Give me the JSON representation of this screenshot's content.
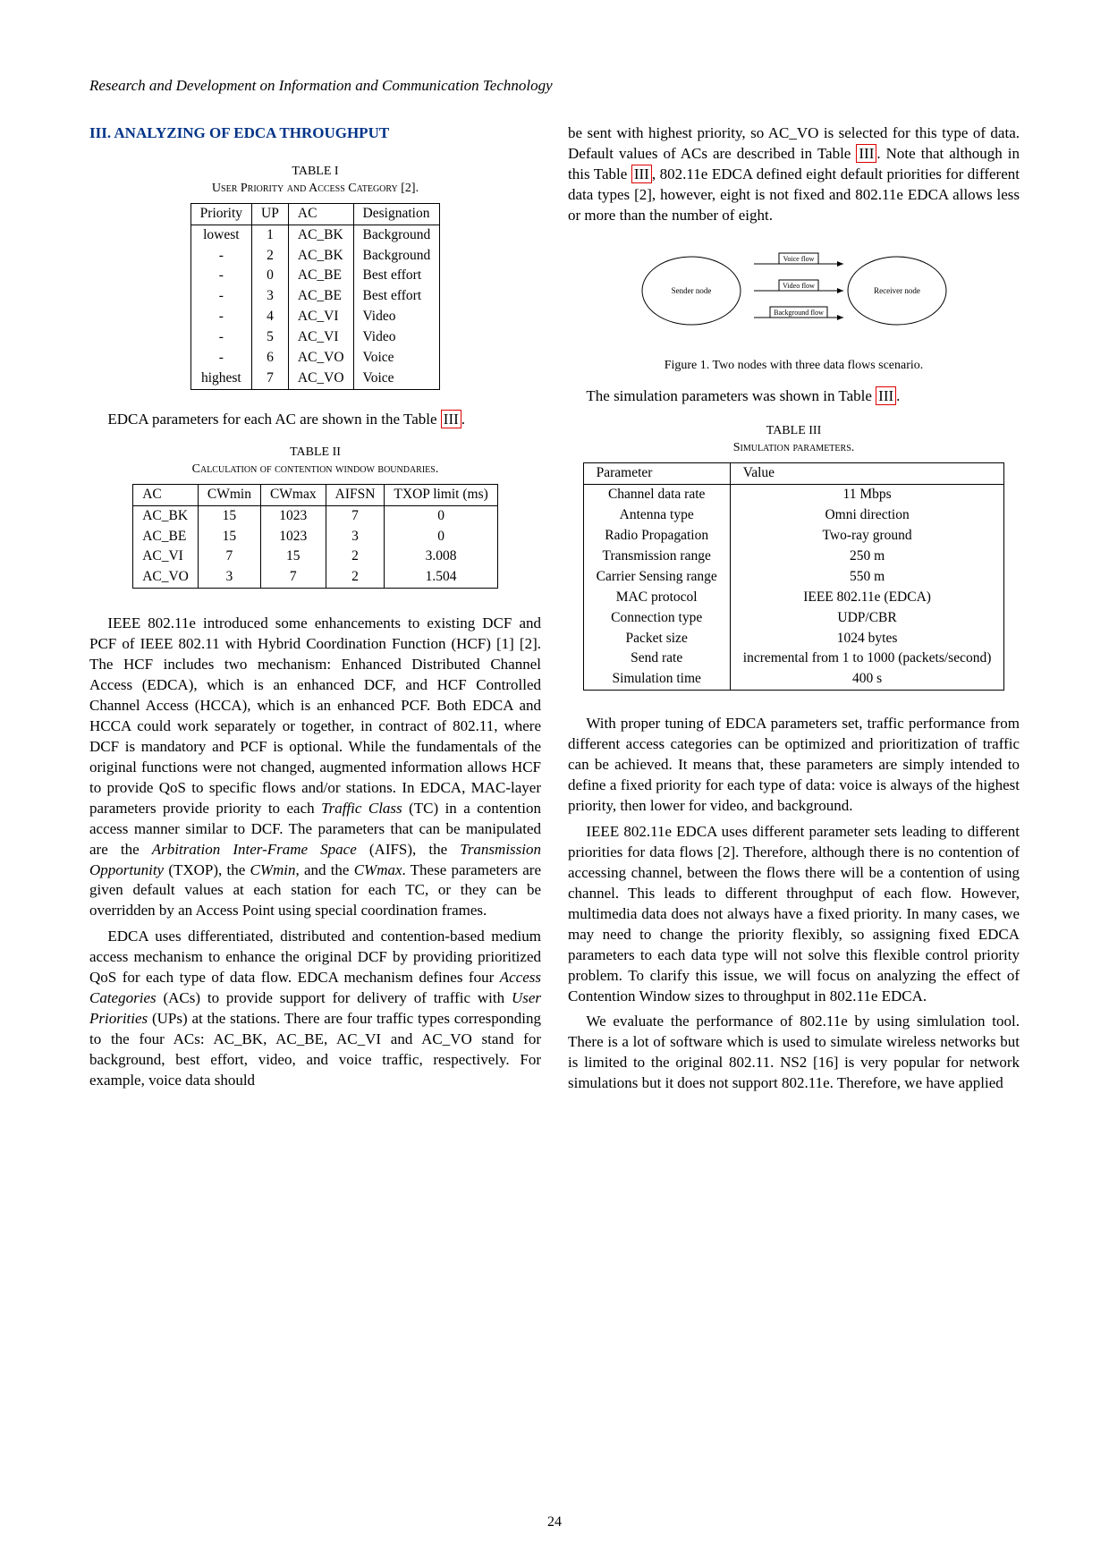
{
  "header": "Research and Development on Information and Communication Technology",
  "section_title": "III. ANALYZING OF EDCA THROUGHPUT",
  "page_number": "24",
  "table1": {
    "label": "TABLE I",
    "caption_pre": "User Priority and Access Category [",
    "caption_ref": "2",
    "caption_post": "].",
    "headers": [
      "Priority",
      "UP",
      "AC",
      "Designation"
    ],
    "rows": [
      [
        "lowest",
        "1",
        "AC_BK",
        "Background"
      ],
      [
        "-",
        "2",
        "AC_BK",
        "Background"
      ],
      [
        "-",
        "0",
        "AC_BE",
        "Best effort"
      ],
      [
        "-",
        "3",
        "AC_BE",
        "Best effort"
      ],
      [
        "-",
        "4",
        "AC_VI",
        "Video"
      ],
      [
        "-",
        "5",
        "AC_VI",
        "Video"
      ],
      [
        "-",
        "6",
        "AC_VO",
        "Voice"
      ],
      [
        "highest",
        "7",
        "AC_VO",
        "Voice"
      ]
    ]
  },
  "para_after_t1_a": "EDCA parameters for each AC are shown in the Table ",
  "para_after_t1_ref": "III",
  "para_after_t1_b": ".",
  "table2": {
    "label": "TABLE II",
    "caption": "Calculation of contention window boundaries.",
    "headers": [
      "AC",
      "CWmin",
      "CWmax",
      "AIFSN",
      "TXOP limit (ms)"
    ],
    "rows": [
      [
        "AC_BK",
        "15",
        "1023",
        "7",
        "0"
      ],
      [
        "AC_BE",
        "15",
        "1023",
        "3",
        "0"
      ],
      [
        "AC_VI",
        "7",
        "15",
        "2",
        "3.008"
      ],
      [
        "AC_VO",
        "3",
        "7",
        "2",
        "1.504"
      ]
    ]
  },
  "para3_a": "IEEE 802.11e introduced some enhancements to existing DCF and PCF of IEEE 802.11 with Hybrid Coordination Function (HCF) [",
  "para3_ref1": "1",
  "para3_mid": "] [",
  "para3_ref2": "2",
  "para3_b": "]. The HCF includes two mechanism: Enhanced Distributed Channel Access (EDCA), which is an enhanced DCF, and HCF Controlled Channel Access (HCCA), which is an enhanced PCF. Both EDCA and HCCA could work separately or together, in contract of 802.11, where DCF is mandatory and PCF is optional. While the fundamentals of the original functions were not changed, augmented information allows HCF to provide QoS to specific flows and/or stations. In EDCA, MAC-layer parameters provide priority to each ",
  "para3_tc": "Traffic Class",
  "para3_c": " (TC) in a contention access manner similar to DCF. The parameters that can be manipulated are the ",
  "para3_aifs": "Arbitration Inter-Frame Space",
  "para3_d": " (AIFS), the ",
  "para3_txop": "Transmission Opportunity",
  "para3_e": " (TXOP), the ",
  "para3_cwmin": "CWmin",
  "para3_f": ", and the ",
  "para3_cwmax": "CWmax",
  "para3_g": ". These parameters are given default values at each station for each TC, or they can be overridden by an Access Point using special coordination frames.",
  "para4_a": "EDCA uses differentiated, distributed and contention-based medium access mechanism to enhance the original DCF by providing prioritized QoS for each type of data flow. EDCA mechanism defines four ",
  "para4_ac": "Access Categories",
  "para4_b": " (ACs) to provide support for delivery of traffic with ",
  "para4_up": "User Priorities",
  "para4_c": " (UPs) at the stations. There are four traffic types corresponding to the four ACs: AC_BK, AC_BE, AC_VI and AC_VO stand for background, best effort, video, and voice traffic, respectively. For example, voice data should",
  "rcol_para1_a": "be sent with highest priority, so AC_VO is selected for this type of data. Default values of ACs are described in Table ",
  "rcol_para1_ref1": "III",
  "rcol_para1_b": ". Note that although in this Table ",
  "rcol_para1_ref2": "III",
  "rcol_para1_c": ", 802.11e EDCA defined eight default priorities for different data types [",
  "rcol_para1_ref3": "2",
  "rcol_para1_d": "], however, eight is not fixed and 802.11e EDCA allows less or more than the number of eight.",
  "figure1": {
    "sender": "Sender node",
    "receiver": "Receiver node",
    "flow1": "Voice flow",
    "flow2": "Video flow",
    "flow3": "Background flow",
    "caption": "Figure 1.  Two nodes with three data flows scenario."
  },
  "rcol_para2_a": "The simulation parameters was shown in Table ",
  "rcol_para2_ref": "III",
  "rcol_para2_b": ".",
  "table3": {
    "label": "TABLE III",
    "caption": "Simulation parameters.",
    "headers": [
      "Parameter",
      "Value"
    ],
    "rows": [
      [
        "Channel data rate",
        "11 Mbps"
      ],
      [
        "Antenna type",
        "Omni direction"
      ],
      [
        "Radio Propagation",
        "Two-ray ground"
      ],
      [
        "Transmission range",
        "250 m"
      ],
      [
        "Carrier Sensing range",
        "550 m"
      ],
      [
        "MAC protocol",
        "IEEE 802.11e (EDCA)"
      ],
      [
        "Connection type",
        "UDP/CBR"
      ],
      [
        "Packet size",
        "1024 bytes"
      ],
      [
        "Send rate",
        "incremental from 1 to 1000 (packets/second)"
      ],
      [
        "Simulation time",
        "400 s"
      ]
    ]
  },
  "rcol_para3": "With proper tuning of EDCA parameters set, traffic performance from different access categories can be optimized and prioritization of traffic can be achieved. It means that, these parameters are simply intended to define a fixed priority for each type of data: voice is always of the highest priority, then lower for video, and background.",
  "rcol_para4_a": "IEEE 802.11e EDCA uses different parameter sets leading to different priorities for data flows [",
  "rcol_para4_ref": "2",
  "rcol_para4_b": "]. Therefore, although there is no contention of accessing channel, between the flows there will be a contention of using channel. This leads to different throughput of each flow. However, multimedia data does not always have a fixed priority. In many cases, we may need to change the priority flexibly, so assigning fixed EDCA parameters to each data type will not solve this flexible control priority problem. To clarify this issue, we will focus on analyzing the effect of Contention Window sizes to throughput in 802.11e EDCA.",
  "rcol_para5_a": "We evaluate the performance of 802.11e by using simlulation tool. There is a lot of software which is used to simulate wireless networks but is limited to the original 802.11. NS2 [",
  "rcol_para5_ref": "16",
  "rcol_para5_b": "] is very popular for network simulations but it does not support 802.11e. Therefore, we have applied"
}
